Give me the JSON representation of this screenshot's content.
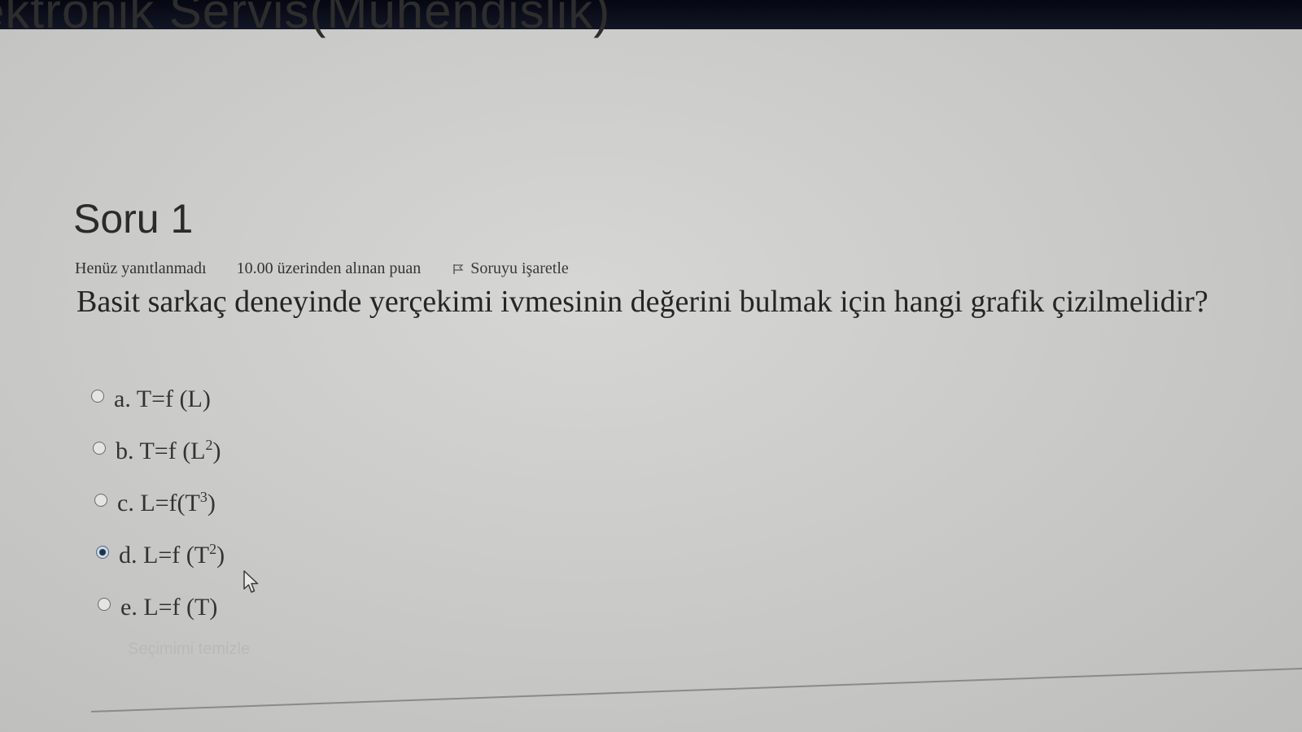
{
  "header": {
    "title": "ektronik Servis(Mühendislik)"
  },
  "question": {
    "number_label": "Soru 1",
    "status": "Henüz yanıtlanmadı",
    "grade_info": "10.00 üzerinden alınan puan",
    "flag_label": "Soruyu işaretle",
    "flag_icon": "flag-icon",
    "text": "Basit sarkaç deneyinde yerçekimi ivmesinin değerini bulmak için hangi grafik çizilmelidir?"
  },
  "answers": [
    {
      "prefix": "a. T=f (L",
      "sup": "",
      "suffix": ")",
      "selected": false
    },
    {
      "prefix": "b. T=f (L",
      "sup": "2",
      "suffix": ")",
      "selected": false
    },
    {
      "prefix": "c. L=f(T",
      "sup": "3",
      "suffix": ")",
      "selected": false
    },
    {
      "prefix": "d. L=f (T",
      "sup": "2",
      "suffix": ")",
      "selected": true
    },
    {
      "prefix": "e. L=f (T",
      "sup": "",
      "suffix": ")",
      "selected": false
    }
  ],
  "clear_choice_label": "Seçimimi temizle",
  "colors": {
    "selected_radio": "#1a3550",
    "top_bar": "#050712"
  }
}
